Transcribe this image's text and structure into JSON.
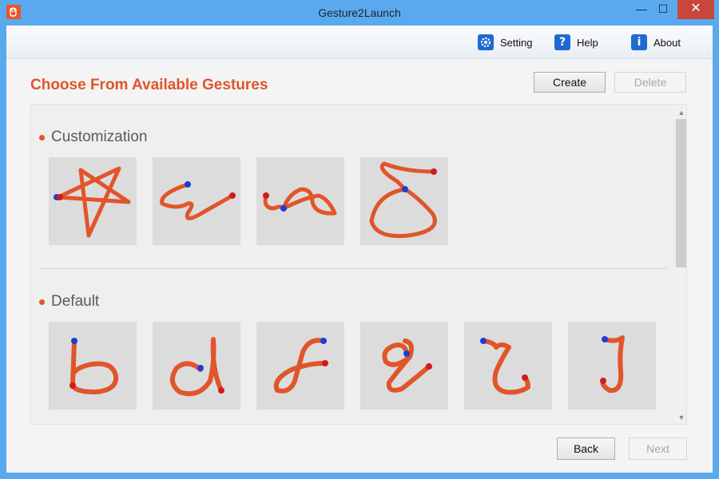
{
  "window": {
    "title": "Gesture2Launch"
  },
  "titlebar": {
    "minimize": "—",
    "maximize": "☐",
    "close": "✕"
  },
  "menu": {
    "setting": {
      "label": "Setting",
      "icon": "gear-icon"
    },
    "help": {
      "label": "Help",
      "icon": "question-icon",
      "glyph": "?"
    },
    "about": {
      "label": "About",
      "icon": "info-icon",
      "glyph": "i"
    }
  },
  "heading": "Choose From Available Gestures",
  "buttons": {
    "create": "Create",
    "delete": "Delete",
    "back": "Back",
    "next": "Next"
  },
  "sections": {
    "customization": {
      "title": "Customization",
      "gestures": [
        "star",
        "zigzag",
        "loop-swirl",
        "figure-loop"
      ]
    },
    "default": {
      "title": "Default",
      "gestures": [
        "b",
        "d",
        "f",
        "g",
        "l",
        "j"
      ]
    }
  },
  "colors": {
    "accent": "#e0552a",
    "stroke": "#e0552a",
    "start_dot": "#d11b1b",
    "end_dot": "#1a3fd6",
    "titlebar": "#5aa9ef"
  }
}
